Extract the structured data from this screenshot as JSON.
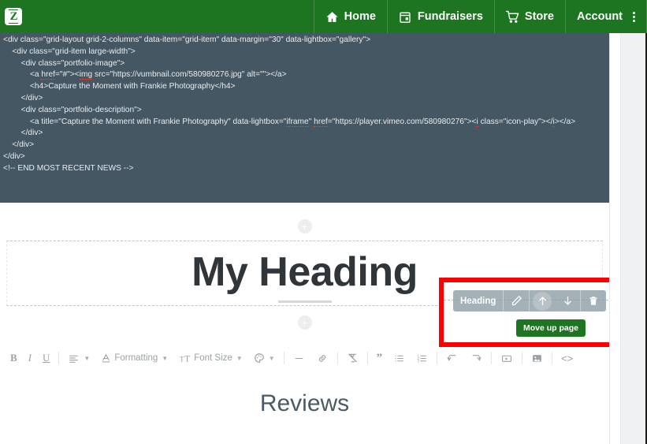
{
  "topbar": {
    "logo_letter": "Z",
    "logo_name": "zenfolio-logo",
    "items": [
      {
        "label": "Home",
        "icon": "home-icon"
      },
      {
        "label": "Fundraisers",
        "icon": "calendar-icon"
      },
      {
        "label": "Store",
        "icon": "cart-icon"
      },
      {
        "label": "Account",
        "icon": "kebab-menu-icon"
      }
    ]
  },
  "code_panel": {
    "lines": [
      "<div class=\"grid-layout grid-2-columns\" data-item=\"grid-item\" data-margin=\"30\" data-lightbox=\"gallery\">",
      "    <div class=\"grid-item large-width\">",
      "        <div class=\"portfolio-image\">",
      "            <a href=\"#\"><img src=\"https://vumbnail.com/580980276.jpg\" alt=\"\"></a>",
      "            <h4>Capture the Moment with Frankie Photography</h4>",
      "        </div>",
      "        <div class=\"portfolio-description\">",
      "            <a title=\"Capture the Moment with Frankie Photography\" data-lightbox=\"iframe\" href=\"https://player.vimeo.com/580980276\"><i class=\"icon-play\"></i></a>",
      "        </div>",
      "    </div>",
      "</div>",
      "<!-- END MOST RECENT NEWS -->"
    ],
    "misspelled": [
      "href",
      "img",
      "i",
      "iframe"
    ]
  },
  "canvas": {
    "add_block_top_label": "+",
    "add_block_bottom_label": "+",
    "heading_text": "My Heading",
    "reviews_text": "Reviews"
  },
  "element_toolbar": {
    "tag_label": "Heading",
    "buttons": [
      {
        "name": "edit-pencil-icon",
        "title": "Edit"
      },
      {
        "name": "move-up-icon",
        "title": "Move up page"
      },
      {
        "name": "move-down-icon",
        "title": "Move down page"
      },
      {
        "name": "delete-trash-icon",
        "title": "Delete"
      }
    ],
    "tooltip": "Move up page",
    "tooltip_color": "#1e7521",
    "highlight_color": "#fc0000"
  },
  "editor_toolbar": {
    "items": [
      {
        "name": "bold-button",
        "label": "B"
      },
      {
        "name": "italic-button",
        "label": "I"
      },
      {
        "name": "underline-button",
        "label": "U"
      },
      {
        "name": "align-button",
        "label": ""
      },
      {
        "name": "formatting-dropdown",
        "label": "Formatting"
      },
      {
        "name": "font-size-dropdown",
        "label": "Font Size"
      },
      {
        "name": "text-color-dropdown",
        "label": ""
      },
      {
        "name": "horizontal-rule-button",
        "label": ""
      },
      {
        "name": "insert-link-button",
        "label": ""
      },
      {
        "name": "clear-formatting-button",
        "label": ""
      },
      {
        "name": "blockquote-button",
        "label": "”"
      },
      {
        "name": "bullet-list-button",
        "label": ""
      },
      {
        "name": "numbered-list-button",
        "label": ""
      },
      {
        "name": "undo-button",
        "label": ""
      },
      {
        "name": "redo-button",
        "label": ""
      },
      {
        "name": "insert-video-button",
        "label": ""
      },
      {
        "name": "insert-image-button",
        "label": ""
      },
      {
        "name": "source-code-button",
        "label": "<>"
      }
    ]
  },
  "colors": {
    "brand_green": "#1e7521",
    "code_bg": "#445763",
    "highlight_red": "#fc0000",
    "heading_text": "#2f3538"
  }
}
